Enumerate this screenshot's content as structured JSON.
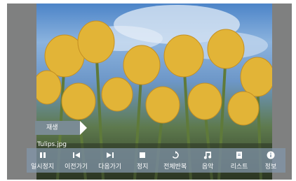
{
  "player": {
    "play_label": "재생",
    "filename": "Tulips.jpg",
    "controls": [
      {
        "label": "일시정지",
        "icon": "pause-icon"
      },
      {
        "label": "이전가기",
        "icon": "previous-icon"
      },
      {
        "label": "다음가기",
        "icon": "next-icon"
      },
      {
        "label": "정지",
        "icon": "stop-icon"
      },
      {
        "label": "전체반복",
        "icon": "repeat-all-icon"
      },
      {
        "label": "음악",
        "icon": "music-icon"
      },
      {
        "label": "리스트",
        "icon": "list-icon"
      },
      {
        "label": "정보",
        "icon": "info-icon"
      }
    ]
  },
  "colors": {
    "frame_bg": "#7f8080",
    "control_bar": "#8296aa",
    "tulip_yellow": "#e2b437",
    "sky_blue": "#4c84c8"
  }
}
